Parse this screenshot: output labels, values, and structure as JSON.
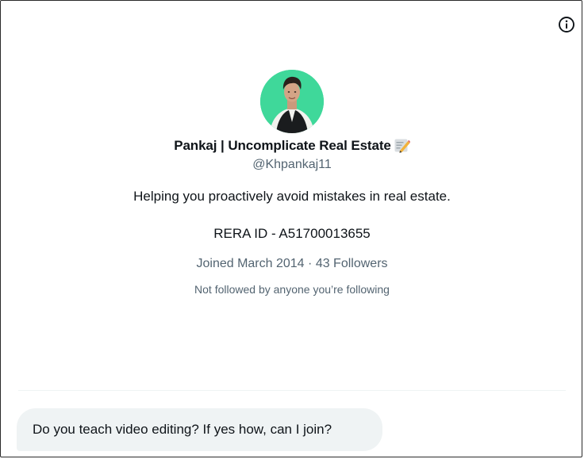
{
  "profile": {
    "display_name": "Pankaj | Uncomplicate Real Estate",
    "name_emoji_icon": "pencil-memo-icon",
    "handle": "@Khpankaj11",
    "bio": "Helping you proactively avoid mistakes in real estate.",
    "rera": "RERA ID - A51700013655",
    "joined": "Joined March 2014",
    "separator": "·",
    "followers": "43 Followers",
    "followed_by_note": "Not followed by anyone you’re following",
    "avatar_bg": "#3fd89a"
  },
  "toolbar": {
    "info_icon": "info-icon"
  },
  "messages": [
    {
      "text": "Do you teach video editing? If yes how, can I join?"
    }
  ]
}
